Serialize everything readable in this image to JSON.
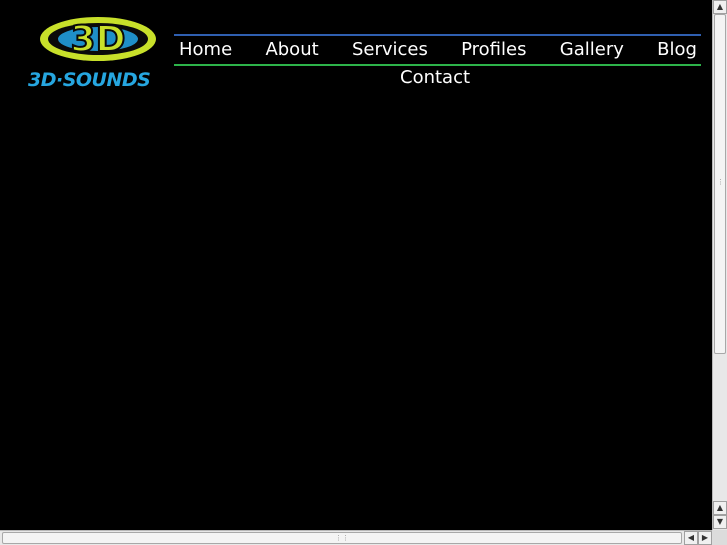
{
  "brand": {
    "logo_mark_text": "3D",
    "logo_text": "3D·SOUNDS",
    "colors": {
      "lime": "#c8e02a",
      "blue": "#26a6e0",
      "dark": "#0a0a0a"
    }
  },
  "nav": {
    "items": [
      {
        "label": "Home"
      },
      {
        "label": "About"
      },
      {
        "label": "Services"
      },
      {
        "label": "Profiles"
      },
      {
        "label": "Gallery"
      },
      {
        "label": "Blog"
      }
    ],
    "contact_label": "Contact",
    "colors": {
      "top_rule": "#2f5fb0",
      "bottom_rule": "#2db34a",
      "text": "#ffffff"
    }
  },
  "scrollbars": {
    "up_icon": "▲",
    "down_icon": "▼",
    "left_icon": "◀",
    "right_icon": "▶",
    "grip_icon": "⋮⋮"
  }
}
